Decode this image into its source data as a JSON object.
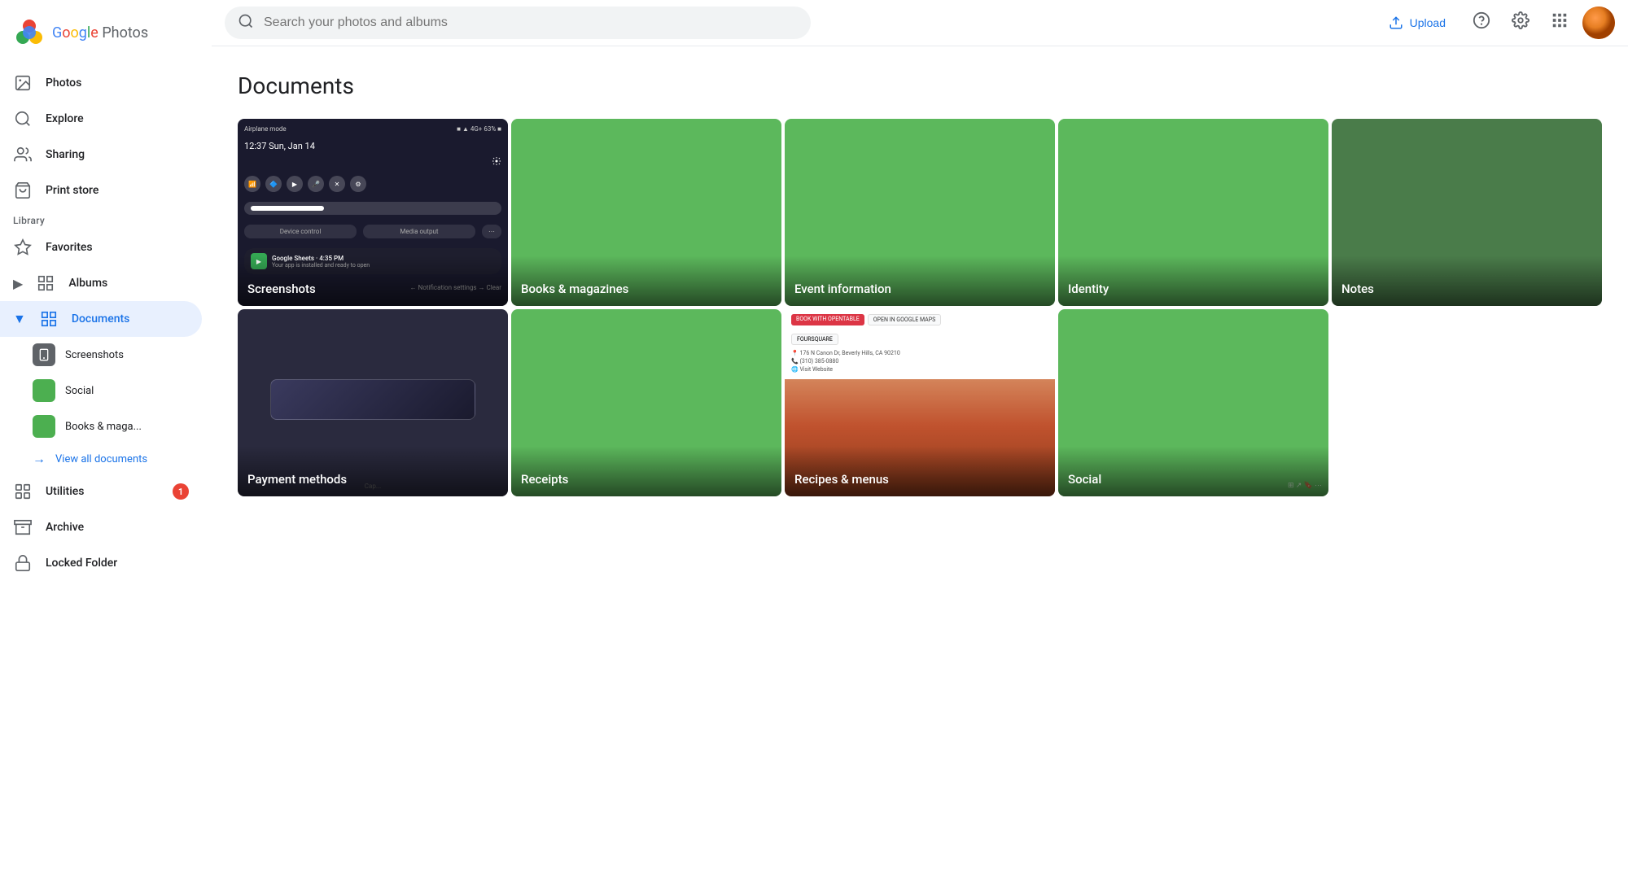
{
  "app": {
    "name": "Google Photos",
    "logo_text": "Google Photos"
  },
  "topbar": {
    "search_placeholder": "Search your photos and albums",
    "upload_label": "Upload",
    "help_icon": "help-circle-icon",
    "settings_icon": "settings-icon",
    "apps_icon": "apps-icon"
  },
  "sidebar": {
    "nav_items": [
      {
        "id": "photos",
        "label": "Photos",
        "icon": "photo-icon"
      },
      {
        "id": "explore",
        "label": "Explore",
        "icon": "explore-icon"
      },
      {
        "id": "sharing",
        "label": "Sharing",
        "icon": "people-icon"
      },
      {
        "id": "print-store",
        "label": "Print store",
        "icon": "bag-icon"
      }
    ],
    "library_label": "Library",
    "library_items": [
      {
        "id": "favorites",
        "label": "Favorites",
        "icon": "star-icon"
      },
      {
        "id": "albums",
        "label": "Albums",
        "icon": "album-icon",
        "expandable": true
      },
      {
        "id": "documents",
        "label": "Documents",
        "icon": "grid-icon",
        "active": true,
        "expandable": true
      }
    ],
    "documents_subitems": [
      {
        "id": "screenshots",
        "label": "Screenshots",
        "color": "gray"
      },
      {
        "id": "social",
        "label": "Social",
        "color": "green"
      },
      {
        "id": "books",
        "label": "Books & maga...",
        "color": "green"
      }
    ],
    "view_all_label": "View all documents",
    "utilities_label": "Utilities",
    "utilities_badge": "1",
    "archive_label": "Archive",
    "locked_folder_label": "Locked Folder"
  },
  "page": {
    "title": "Documents"
  },
  "grid": {
    "row1": [
      {
        "id": "screenshots",
        "label": "Screenshots",
        "type": "screenshot"
      },
      {
        "id": "books-magazines",
        "label": "Books & magazines",
        "type": "green"
      },
      {
        "id": "event-information",
        "label": "Event information",
        "type": "green"
      },
      {
        "id": "identity",
        "label": "Identity",
        "type": "green"
      },
      {
        "id": "notes",
        "label": "Notes",
        "type": "green-dark"
      }
    ],
    "row2": [
      {
        "id": "payment-methods",
        "label": "Payment methods",
        "type": "dark"
      },
      {
        "id": "receipts",
        "label": "Receipts",
        "type": "green"
      },
      {
        "id": "recipes-menus",
        "label": "Recipes & menus",
        "type": "recipe"
      },
      {
        "id": "social",
        "label": "Social",
        "type": "green-browser"
      }
    ]
  }
}
